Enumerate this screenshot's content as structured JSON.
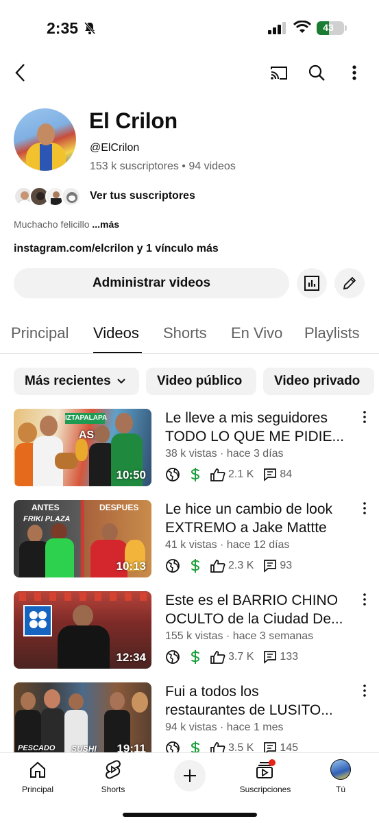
{
  "status_bar": {
    "time": "2:35",
    "battery": "43"
  },
  "channel": {
    "name": "El Crilon",
    "handle": "@ElCrilon",
    "stats": "153 k suscriptores • 94 videos",
    "see_subscribers": "Ver tus suscriptores",
    "description": "Muchacho felicillo",
    "more": "...más",
    "link": "instagram.com/elcrilon y 1 vínculo más",
    "manage_label": "Administrar videos"
  },
  "tabs": [
    "Principal",
    "Videos",
    "Shorts",
    "En Vivo",
    "Playlists"
  ],
  "active_tab": "Videos",
  "chips": [
    "Más recientes",
    "Video público",
    "Video privado"
  ],
  "videos": [
    {
      "title1": "Le lleve a mis seguidores",
      "title2": "TODO LO QUE ME PIDIE...",
      "meta": "38 k vistas · hace 3 días",
      "duration": "10:50",
      "likes": "2.1 K",
      "comments": "84",
      "thumb_text": [
        "IZTAPALAPA",
        "ASP"
      ]
    },
    {
      "title1": "Le hice un cambio de look",
      "title2": "EXTREMO a Jake Mattte",
      "meta": "41 k vistas · hace 12 días",
      "duration": "10:13",
      "likes": "2.3 K",
      "comments": "93",
      "thumb_text": [
        "ANTES",
        "DESPUES",
        "FRIKI PLAZA"
      ]
    },
    {
      "title1": "Este es el BARRIO CHINO",
      "title2": "OCULTO de la Ciudad De...",
      "meta": "155 k vistas · hace 3 semanas",
      "duration": "12:34",
      "likes": "3.7 K",
      "comments": "133",
      "thumb_text": []
    },
    {
      "title1": "Fui a todos los",
      "title2": "restaurantes de LUSITO...",
      "meta": "94 k vistas · hace 1 mes",
      "duration": "19:11",
      "likes": "3.5 K",
      "comments": "145",
      "thumb_text": [
        "PESCADO",
        "SUSHI"
      ]
    }
  ],
  "bottom_nav": [
    "Principal",
    "Shorts",
    "Suscripciones",
    "Tú"
  ],
  "colors": {
    "accent": "#0f0f0f",
    "secondary_text": "#606060",
    "chip_bg": "#f2f2f2",
    "monetized": "#1e9e3a",
    "notification_dot": "#e62117"
  }
}
